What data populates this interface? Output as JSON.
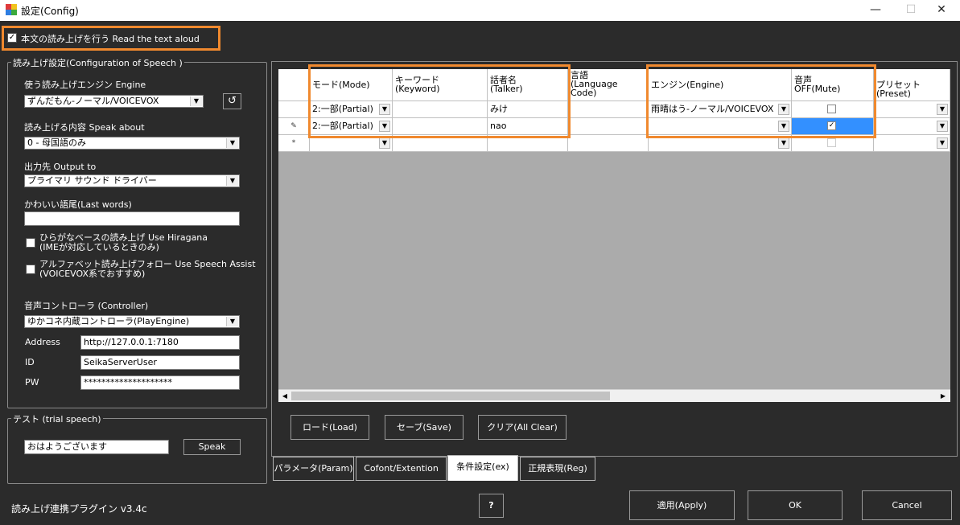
{
  "window": {
    "title": "設定(Config)",
    "minimize_glyph": "—",
    "maximize_glyph": "☐",
    "close_glyph": "✕"
  },
  "read_aloud": {
    "label": "本文の読み上げを行う  Read the text aloud",
    "checked": true
  },
  "speech_group": {
    "title": "読み上げ設定(Configuration of Speech )",
    "engine_label": "使う読み上げエンジン   Engine",
    "engine_value": "ずんだもん-ノーマル/VOICEVOX",
    "refresh_glyph": "↺",
    "speak_about_label": "読み上げる内容 Speak about",
    "speak_about_value": "0 - 母国語のみ",
    "output_label": "出力先    Output to",
    "output_value": "プライマリ サウンド ドライバー",
    "last_words_label": "かわいい語尾(Last words)",
    "last_words_value": "",
    "hiragana_label_1": "ひらがなベースの読み上げ  Use Hiragana",
    "hiragana_label_2": "(IMEが対応しているときのみ)",
    "assist_label_1": "アルファベット読み上げフォロー  Use Speech Assist",
    "assist_label_2": "(VOICEVOX系でおすすめ)",
    "controller_label": "音声コントローラ (Controller)",
    "controller_value": "ゆかコネ内蔵コントローラ(PlayEngine)",
    "address_label": "Address",
    "address_value": "http://127.0.0.1:7180",
    "id_label": "ID",
    "id_value": "SeikaServerUser",
    "pw_label": "PW",
    "pw_value": "********************"
  },
  "trial_group": {
    "title": "テスト (trial speech)",
    "text_value": "おはようございます",
    "speak_button": "Speak"
  },
  "grid": {
    "headers": {
      "mode": "モード(Mode)",
      "keyword": "キーワード\n(Keyword)",
      "talker": "話者名\n(Talker)",
      "language": "言語\n(Language\nCode)",
      "engine": "エンジン(Engine)",
      "mute": "音声\nOFF(Mute)",
      "preset": "プリセット(Preset)"
    },
    "rows": [
      {
        "indicator": "",
        "mode": "2:一部(Partial)",
        "keyword": "",
        "talker": "みけ",
        "language": "",
        "engine": "雨晴はう-ノーマル/VOICEVOX",
        "mute": false,
        "preset": ""
      },
      {
        "indicator": "✎",
        "mode": "2:一部(Partial)",
        "keyword": "",
        "talker": "nao",
        "language": "",
        "engine": "",
        "mute": true,
        "preset": ""
      },
      {
        "indicator": "*",
        "mode": "",
        "keyword": "",
        "talker": "",
        "language": "",
        "engine": "",
        "mute": false,
        "preset": ""
      }
    ]
  },
  "buttons": {
    "load": "ロード(Load)",
    "save": "セーブ(Save)",
    "clear": "クリア(All Clear)"
  },
  "tabs": [
    "パラメータ(Param)",
    "Cofont/Extention",
    "条件設定(ex)",
    "正規表現(Reg)"
  ],
  "footer": {
    "plugin_name": "読み上げ連携プラグイン v3.4c",
    "help": "?",
    "apply": "適用(Apply)",
    "ok": "OK",
    "cancel": "Cancel"
  },
  "colors": {
    "accent_highlight": "#f0892e",
    "selection": "#3390ff",
    "background": "#2b2b2b"
  }
}
